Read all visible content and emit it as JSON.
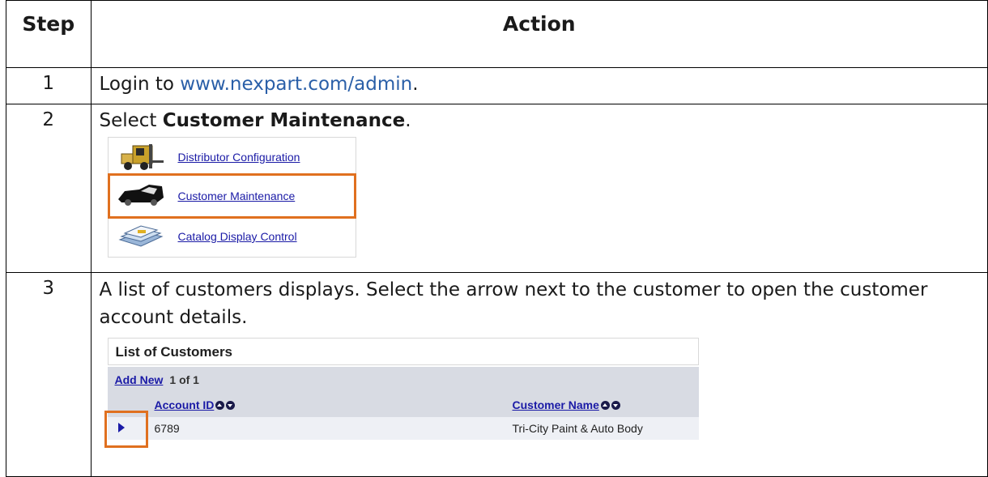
{
  "table": {
    "headers": {
      "step": "Step",
      "action": "Action"
    },
    "rows": [
      {
        "step": "1",
        "pre": "Login to ",
        "link": "www.nexpart.com/admin",
        "post": "."
      },
      {
        "step": "2",
        "pre": "Select ",
        "bold": "Customer Maintenance",
        "post": "."
      },
      {
        "step": "3",
        "text": "A list of customers displays. Select the arrow next to the customer to open the customer account details."
      }
    ]
  },
  "menu": {
    "items": [
      {
        "label": "Distributor Configuration",
        "icon": "forklift-icon"
      },
      {
        "label": "Customer Maintenance",
        "icon": "car-icon"
      },
      {
        "label": "Catalog Display Control",
        "icon": "catalog-icon"
      }
    ]
  },
  "customer_list": {
    "title": "List of Customers",
    "add_new": "Add New",
    "count": "1 of 1",
    "columns": [
      "Account ID",
      "Customer Name"
    ],
    "rows": [
      {
        "account_id": "6789",
        "customer_name": "Tri-City Paint & Auto Body"
      }
    ]
  },
  "colors": {
    "highlight": "#e0701f",
    "link": "#2a5fa8",
    "ui_link": "#1a1aa6"
  }
}
